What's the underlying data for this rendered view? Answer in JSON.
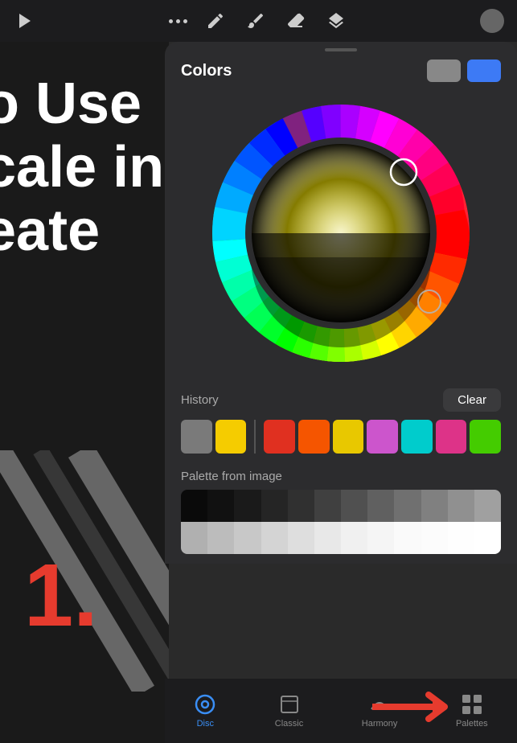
{
  "toolbar": {
    "arrow_icon": "↗",
    "pencil_icon": "pencil",
    "brush_icon": "brush",
    "eraser_icon": "eraser",
    "layers_icon": "layers",
    "avatar_icon": "avatar"
  },
  "panel": {
    "handle_visible": true,
    "title": "Colors",
    "swatch_foreground": "#888888",
    "swatch_background": "#3d7af5"
  },
  "wheel": {
    "selector_angle": 45,
    "selected_color": "#d4b800"
  },
  "history": {
    "label": "History",
    "clear_button": "Clear",
    "swatches": [
      {
        "color": "#7a7a7a"
      },
      {
        "color": "#f5cc00"
      }
    ],
    "recent_swatches": [
      {
        "color": "#e03020"
      },
      {
        "color": "#f55500"
      },
      {
        "color": "#e8c800"
      },
      {
        "color": "#cc55cc"
      },
      {
        "color": "#00cccc"
      },
      {
        "color": "#dd3388"
      },
      {
        "color": "#44cc00"
      }
    ]
  },
  "palette": {
    "label": "Palette from image"
  },
  "tabs": [
    {
      "id": "disc",
      "label": "Disc",
      "active": true
    },
    {
      "id": "classic",
      "label": "Classic",
      "active": false
    },
    {
      "id": "harmony",
      "label": "Harmony",
      "active": false
    },
    {
      "id": "palettes",
      "label": "Palettes",
      "active": false
    }
  ],
  "canvas": {
    "text_line1": "o Use",
    "text_line2": "cale in",
    "text_line3": "eate",
    "number": "1."
  }
}
